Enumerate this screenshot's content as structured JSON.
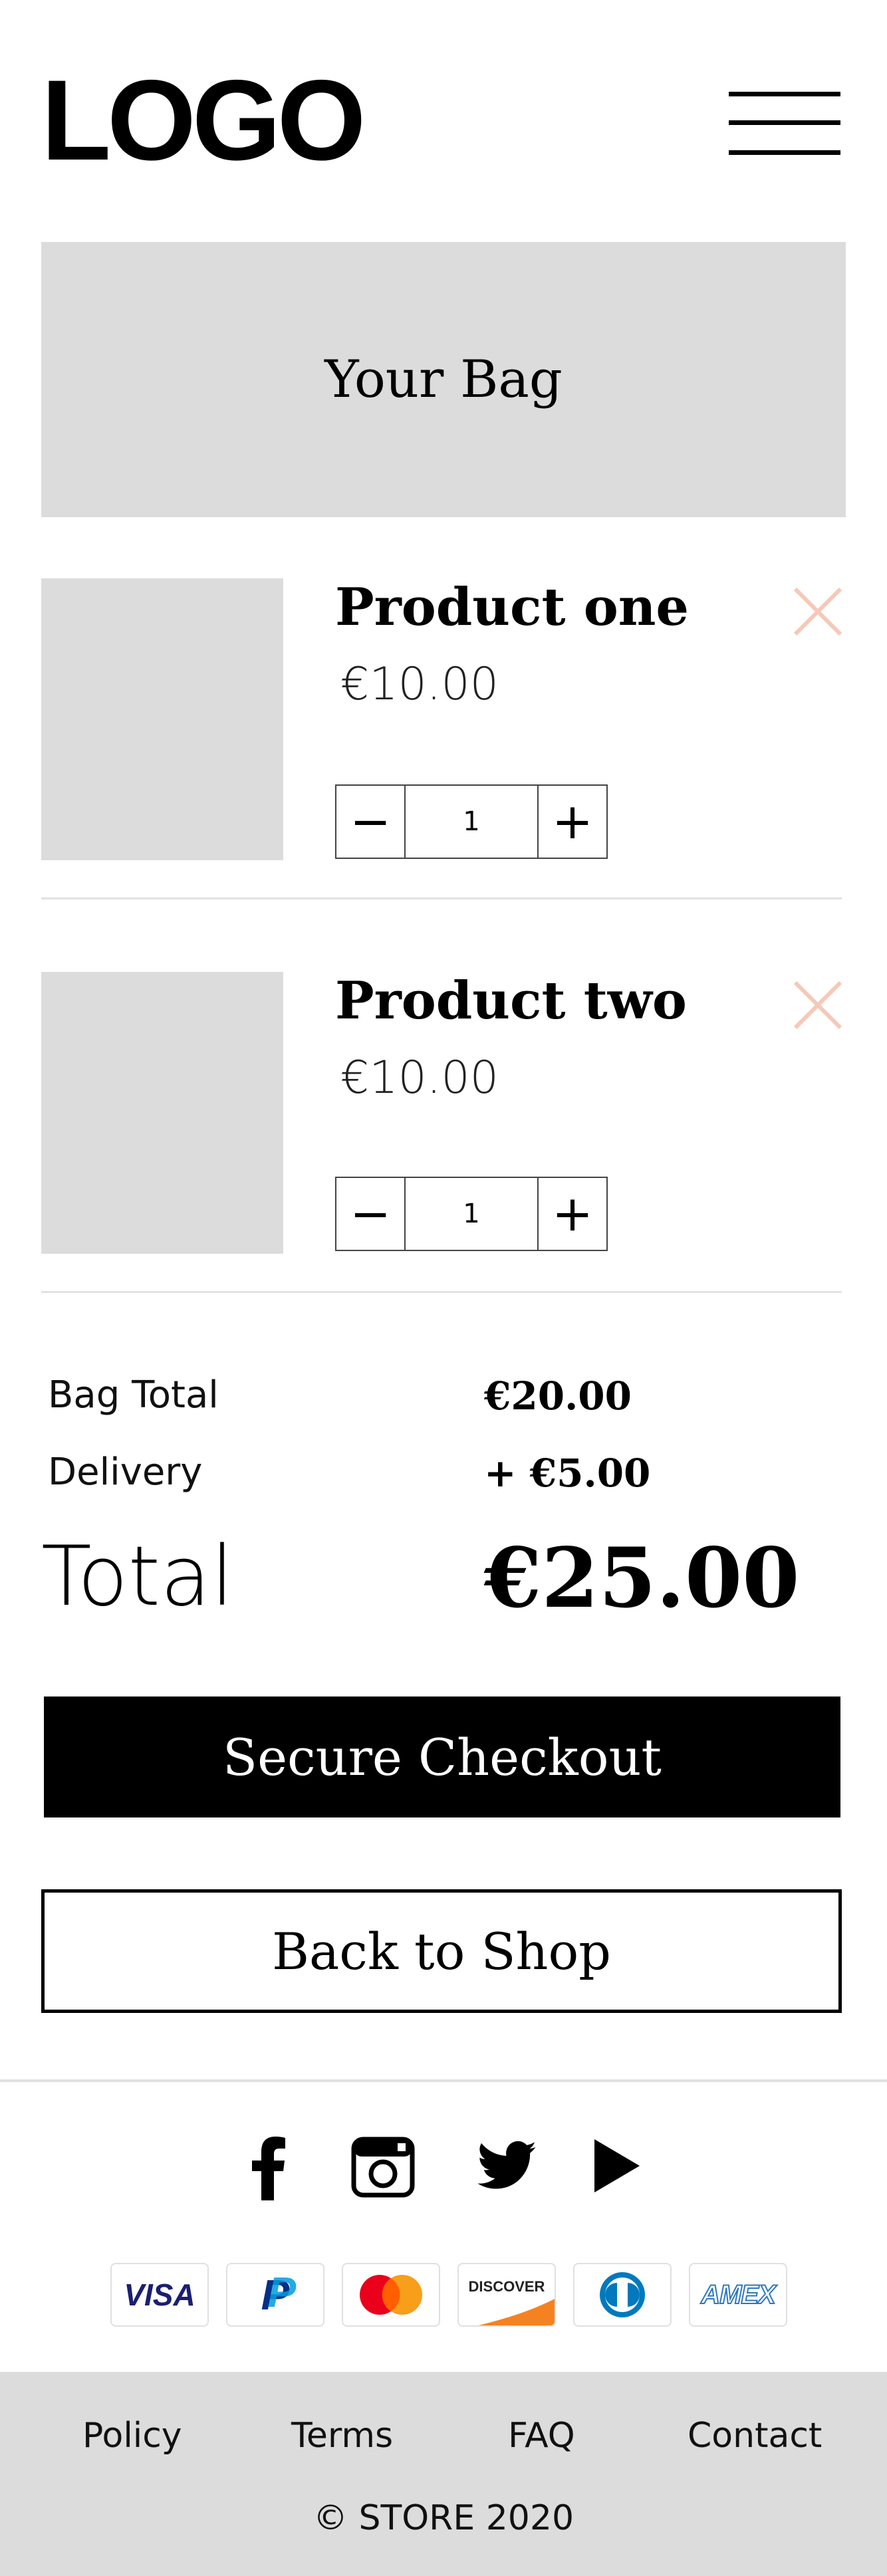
{
  "header": {
    "logo": "LOGO",
    "menu_icon": "hamburger-menu-icon"
  },
  "bag": {
    "title": "Your Bag"
  },
  "items": [
    {
      "name": "Product one",
      "price": "€10.00",
      "qty": "1"
    },
    {
      "name": "Product two",
      "price": "€10.00",
      "qty": "1"
    }
  ],
  "qty_controls": {
    "minus": "−",
    "plus": "+"
  },
  "summary": {
    "bag_total_label": "Bag Total",
    "bag_total_value": "€20.00",
    "delivery_label": "Delivery",
    "delivery_value": "+ €5.00",
    "total_label": "Total",
    "total_value": "€25.00"
  },
  "actions": {
    "checkout": "Secure Checkout",
    "back": "Back to Shop"
  },
  "social": [
    "facebook-icon",
    "instagram-icon",
    "twitter-icon",
    "youtube-play-icon"
  ],
  "payments": {
    "visa": "VISA",
    "paypal": "P",
    "discover": "DISCOVER",
    "amex": "AMEX"
  },
  "footer": {
    "links": [
      "Policy",
      "Terms",
      "FAQ",
      "Contact"
    ],
    "copyright": "© STORE 2020"
  },
  "colors": {
    "placeholder": "#dcdcdc",
    "remove_icon": "#f5c9b8",
    "button": "#000000"
  }
}
